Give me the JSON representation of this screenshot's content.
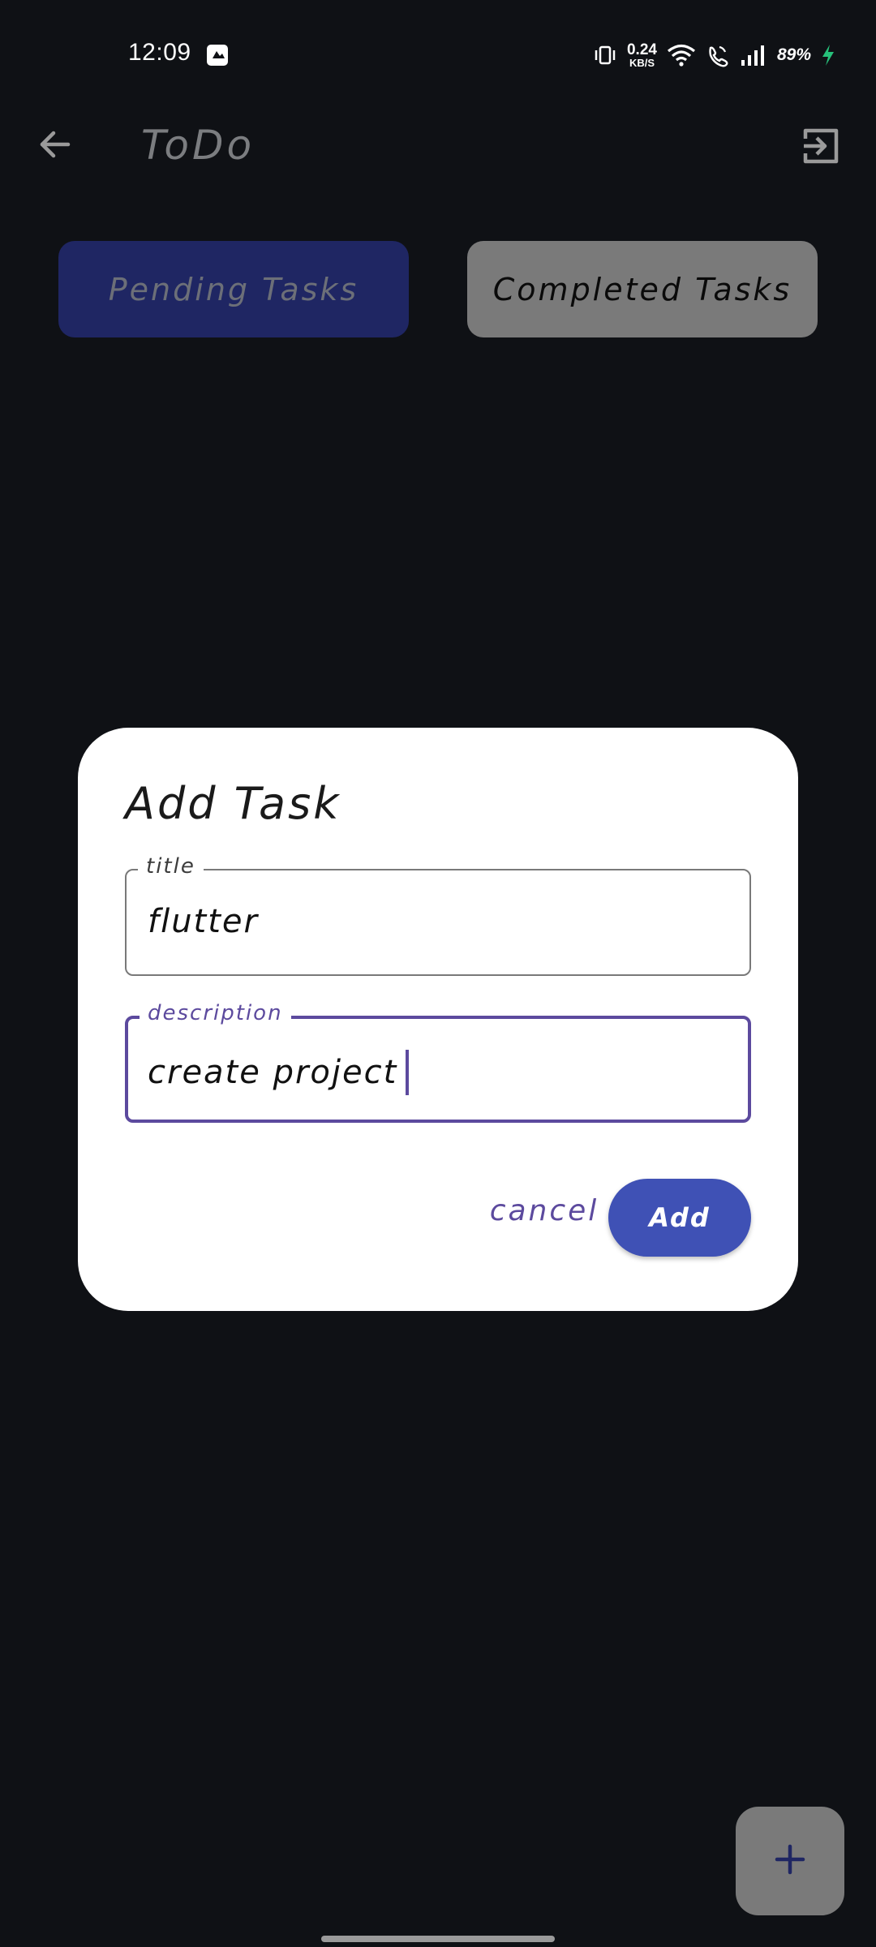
{
  "status_bar": {
    "time": "12:09",
    "net_speed_value": "0.24",
    "net_speed_unit": "KB/S",
    "battery": "89%",
    "icons": [
      "app-notification-icon",
      "vibrate-icon",
      "wifi-icon",
      "wifi-calling-icon",
      "signal-icon",
      "charging-icon"
    ]
  },
  "app_bar": {
    "title": "ToDo",
    "back_icon": "arrow-left-icon",
    "logout_icon": "logout-icon"
  },
  "tabs": {
    "pending_label": "Pending Tasks",
    "completed_label": "Completed Tasks",
    "selected": "Pending Tasks"
  },
  "dialog": {
    "title": "Add Task",
    "title_field": {
      "label": "title",
      "value": "flutter"
    },
    "description_field": {
      "label": "description",
      "value": "create project"
    },
    "cancel_label": "cancel",
    "add_label": "Add"
  },
  "fab": {
    "icon": "plus-icon"
  },
  "colors": {
    "background": "#0f1115",
    "pending_tab": "#1f2663",
    "completed_tab": "#7a7a7a",
    "accent_purple": "#5c4a9e",
    "add_button": "#3f51b5",
    "charging_green": "#27c07a"
  }
}
